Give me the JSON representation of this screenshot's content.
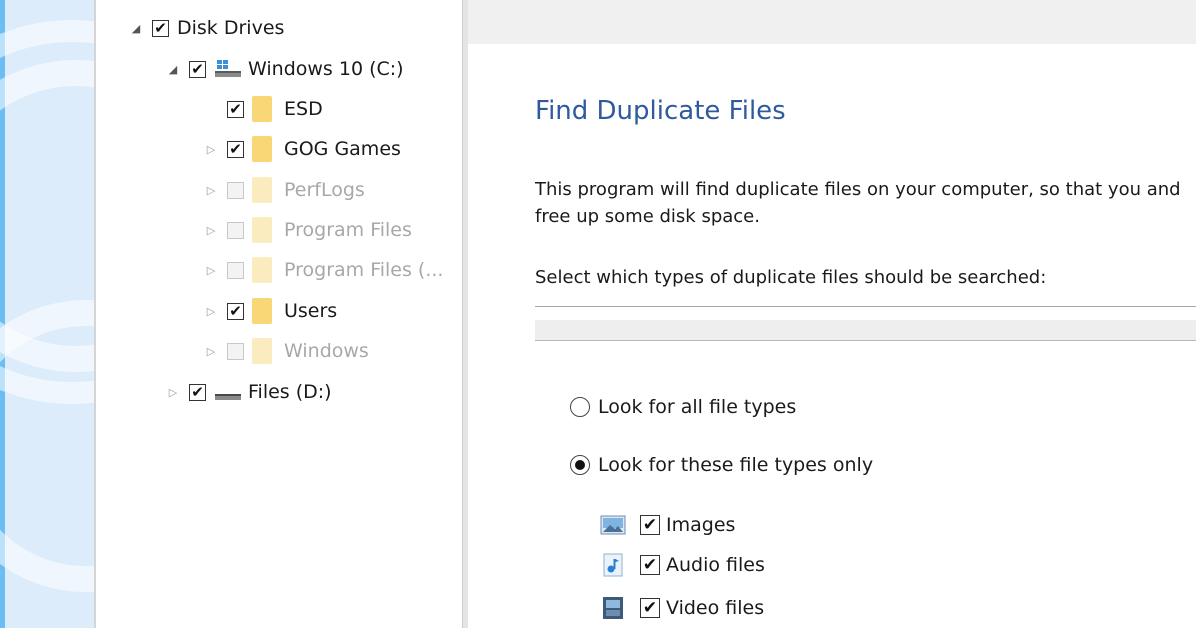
{
  "tree": {
    "root": {
      "label": "Disk Drives",
      "checked": true,
      "expanded": true
    },
    "drives": [
      {
        "label": "Windows 10 (C:)",
        "checked": true,
        "expanded": true,
        "icon": "windows-drive-icon"
      },
      {
        "label": "Files (D:)",
        "checked": true,
        "expanded": false,
        "icon": "hard-drive-icon"
      }
    ],
    "folders": [
      {
        "label": "ESD",
        "checked": true,
        "enabled": true,
        "has_children": false
      },
      {
        "label": "GOG Games",
        "checked": true,
        "enabled": true,
        "has_children": true
      },
      {
        "label": "PerfLogs",
        "checked": false,
        "enabled": false,
        "has_children": true
      },
      {
        "label": "Program Files",
        "checked": false,
        "enabled": false,
        "has_children": true
      },
      {
        "label": "Program Files (...",
        "checked": false,
        "enabled": false,
        "has_children": true
      },
      {
        "label": "Users",
        "checked": true,
        "enabled": true,
        "has_children": true
      },
      {
        "label": "Windows",
        "checked": false,
        "enabled": false,
        "has_children": true
      }
    ]
  },
  "main": {
    "title": "Find Duplicate Files",
    "description": "This program will find duplicate files on your computer, so that you and free up some disk space.",
    "select_label": "Select which types of duplicate files should be searched:",
    "options": [
      {
        "label": "Look for all file types",
        "selected": false
      },
      {
        "label": "Look for these file types only",
        "selected": true
      }
    ],
    "file_types": [
      {
        "label": "Images",
        "checked": true,
        "icon": "image-icon"
      },
      {
        "label": "Audio files",
        "checked": true,
        "icon": "audio-icon"
      },
      {
        "label": "Video files",
        "checked": true,
        "icon": "video-icon"
      }
    ]
  },
  "colors": {
    "heading": "#2f5a9c",
    "folder": "#f9d777",
    "background_accent": "#6cbdf3"
  },
  "checkmark": "✔"
}
